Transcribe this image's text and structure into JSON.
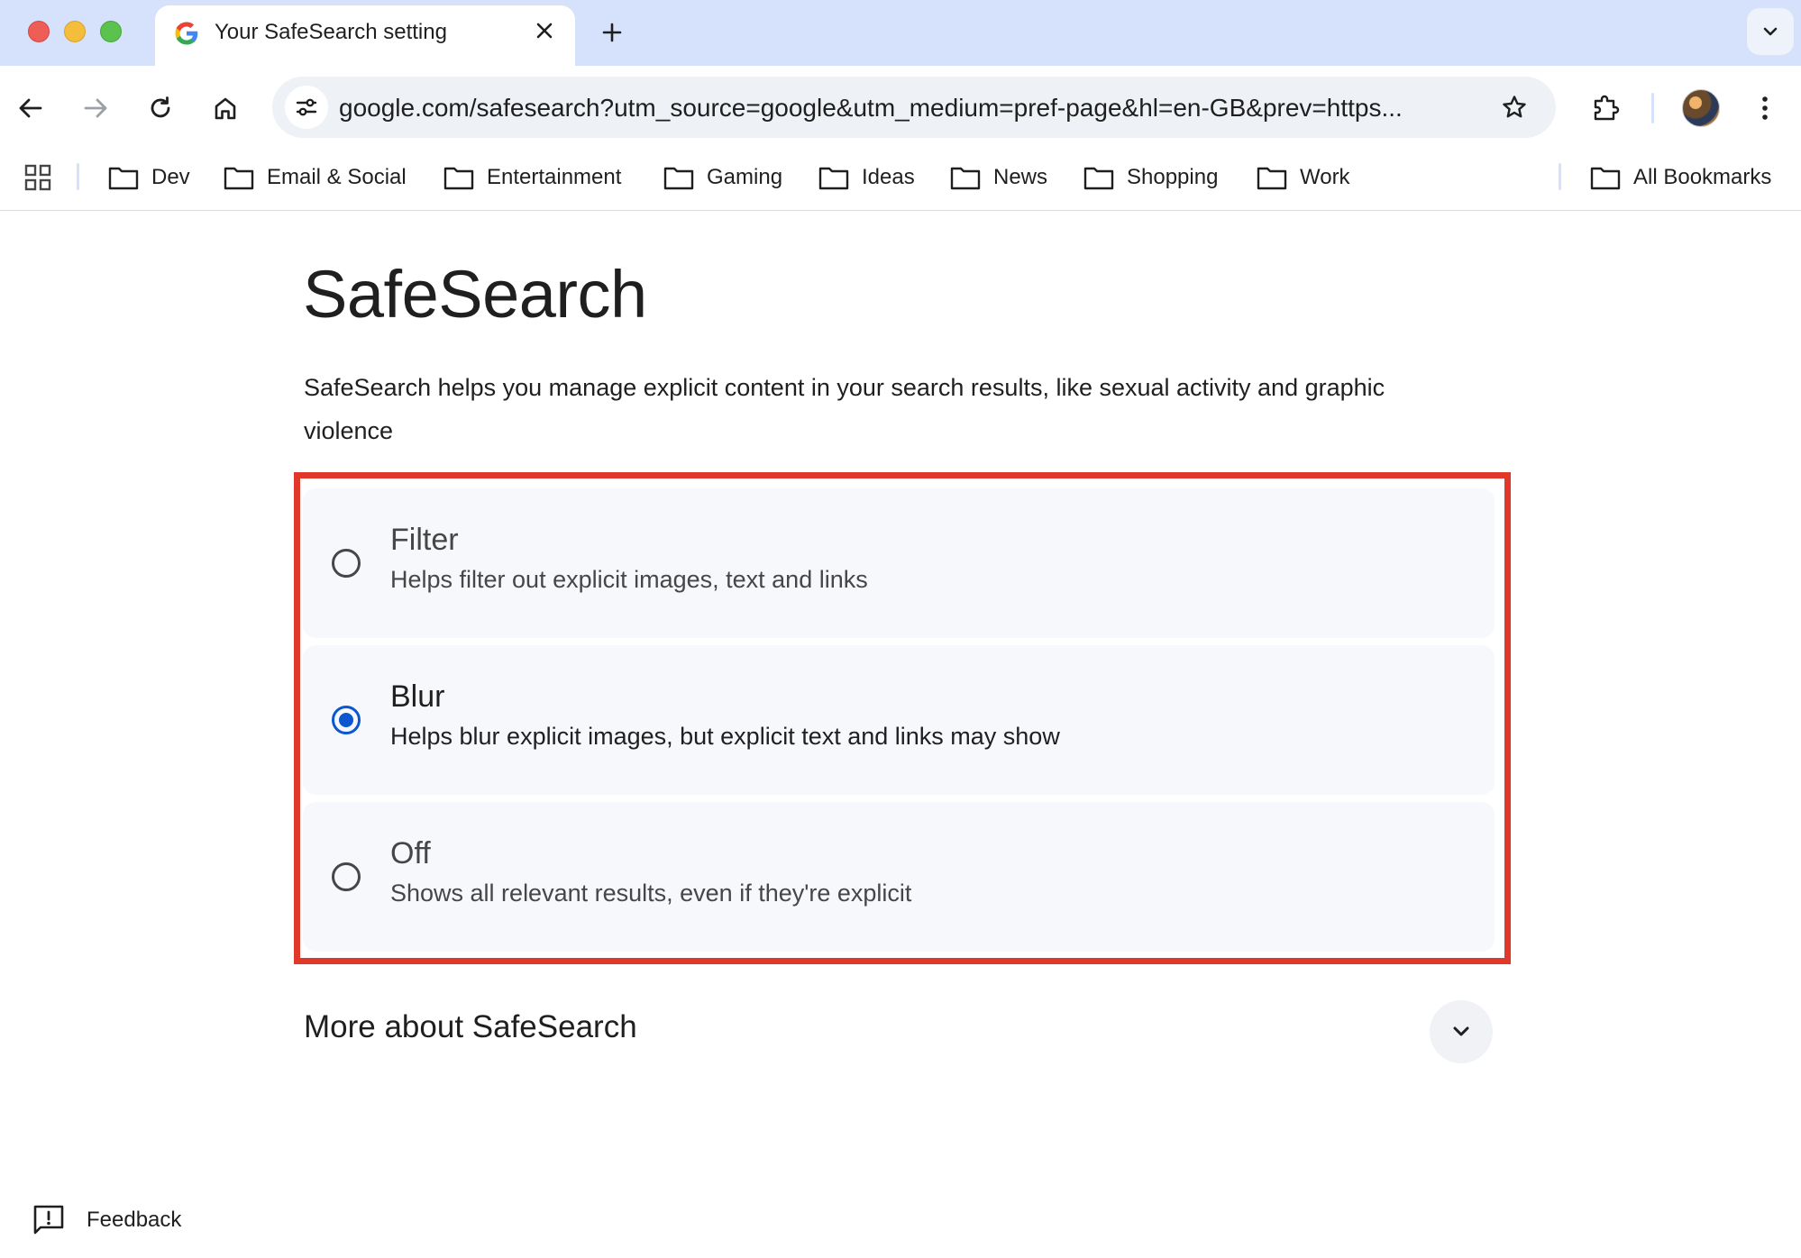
{
  "tab": {
    "title": "Your SafeSearch setting"
  },
  "toolbar": {
    "url": "google.com/safesearch?utm_source=google&utm_medium=pref-page&hl=en-GB&prev=https..."
  },
  "bookmarks": {
    "items": [
      {
        "label": "Dev"
      },
      {
        "label": "Email & Social"
      },
      {
        "label": "Entertainment"
      },
      {
        "label": "Gaming"
      },
      {
        "label": "Ideas"
      },
      {
        "label": "News"
      },
      {
        "label": "Shopping"
      },
      {
        "label": "Work"
      }
    ],
    "all_label": "All Bookmarks"
  },
  "page": {
    "title": "SafeSearch",
    "description": "SafeSearch helps you manage explicit content in your search results, like sexual activity and graphic violence",
    "options": [
      {
        "title": "Filter",
        "description": "Helps filter out explicit images, text and links",
        "selected": false
      },
      {
        "title": "Blur",
        "description": "Helps blur explicit images, but explicit text and links may show",
        "selected": true
      },
      {
        "title": "Off",
        "description": "Shows all relevant results, even if they're explicit",
        "selected": false
      }
    ],
    "more_title": "More about SafeSearch",
    "feedback_label": "Feedback"
  },
  "colors": {
    "accent": "#0b57d0",
    "highlight": "#e0392b",
    "tabstrip": "#d6e2fb"
  }
}
